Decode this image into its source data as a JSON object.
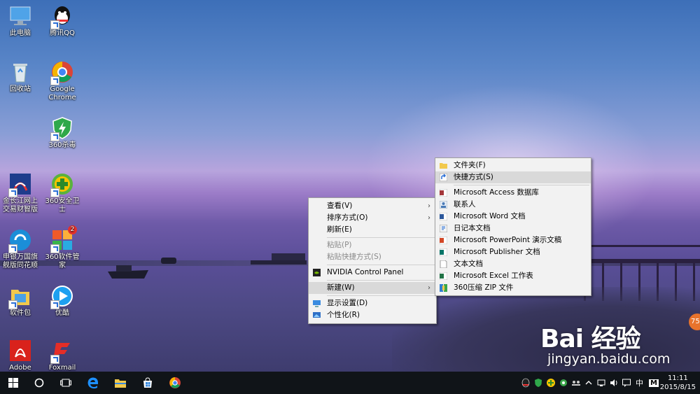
{
  "desktop_icons": [
    {
      "label": "此电脑",
      "icon": "computer-icon"
    },
    {
      "label": "腾讯QQ",
      "icon": "qq-icon"
    },
    {
      "label": "回收站",
      "icon": "recycle-bin-icon"
    },
    {
      "label": "Google Chrome",
      "icon": "chrome-icon"
    },
    {
      "label": "360杀毒",
      "icon": "360-antivirus-icon"
    },
    {
      "label": "金长江网上交易财智版",
      "icon": "jinchangjiang-icon"
    },
    {
      "label": "360安全卫士",
      "icon": "360-security-icon"
    },
    {
      "label": "申银万国旗舰版同花顺",
      "icon": "shenyin-icon"
    },
    {
      "label": "360软件管家",
      "icon": "360-software-icon",
      "badge": "2"
    },
    {
      "label": "软件包",
      "icon": "folder-icon"
    },
    {
      "label": "优酷",
      "icon": "youku-icon"
    },
    {
      "label": "Adobe",
      "icon": "adobe-icon"
    },
    {
      "label": "Foxmail",
      "icon": "foxmail-icon"
    }
  ],
  "context_menu": {
    "items": [
      {
        "label": "查看(V)",
        "submenu": true
      },
      {
        "label": "排序方式(O)",
        "submenu": true
      },
      {
        "label": "刷新(E)"
      },
      {
        "label": "粘贴(P)",
        "disabled": true
      },
      {
        "label": "粘贴快捷方式(S)",
        "disabled": true
      },
      {
        "label": "NVIDIA Control Panel",
        "icon": "nvidia-icon"
      },
      {
        "label": "新建(W)",
        "submenu": true,
        "highlighted": true
      },
      {
        "label": "显示设置(D)",
        "icon": "display-settings-icon"
      },
      {
        "label": "个性化(R)",
        "icon": "personalize-icon"
      }
    ]
  },
  "new_submenu": {
    "items": [
      {
        "label": "文件夹(F)",
        "icon": "folder-icon"
      },
      {
        "label": "快捷方式(S)",
        "icon": "shortcut-icon",
        "highlighted": true
      },
      {
        "label": "Microsoft Access 数据库",
        "icon": "access-icon"
      },
      {
        "label": "联系人",
        "icon": "contact-icon"
      },
      {
        "label": "Microsoft Word 文档",
        "icon": "word-icon"
      },
      {
        "label": "日记本文档",
        "icon": "journal-icon"
      },
      {
        "label": "Microsoft PowerPoint 演示文稿",
        "icon": "powerpoint-icon"
      },
      {
        "label": "Microsoft Publisher 文档",
        "icon": "publisher-icon"
      },
      {
        "label": "文本文档",
        "icon": "text-document-icon"
      },
      {
        "label": "Microsoft Excel 工作表",
        "icon": "excel-icon"
      },
      {
        "label": "360压缩 ZIP 文件",
        "icon": "zip-icon"
      }
    ]
  },
  "taskbar": {
    "ime_label": "中",
    "time": "11:11",
    "date": "2015/8/15",
    "input_indicator": "M"
  },
  "watermark": {
    "brand": "Bai 经验",
    "url": "jingyan.baidu.com"
  },
  "side_badge": "75",
  "colors": {
    "menu_bg": "#f2f2f2",
    "menu_highlight": "#d9d9d9",
    "taskbar_bg": "#101418",
    "accent": "#2a6fd6"
  }
}
